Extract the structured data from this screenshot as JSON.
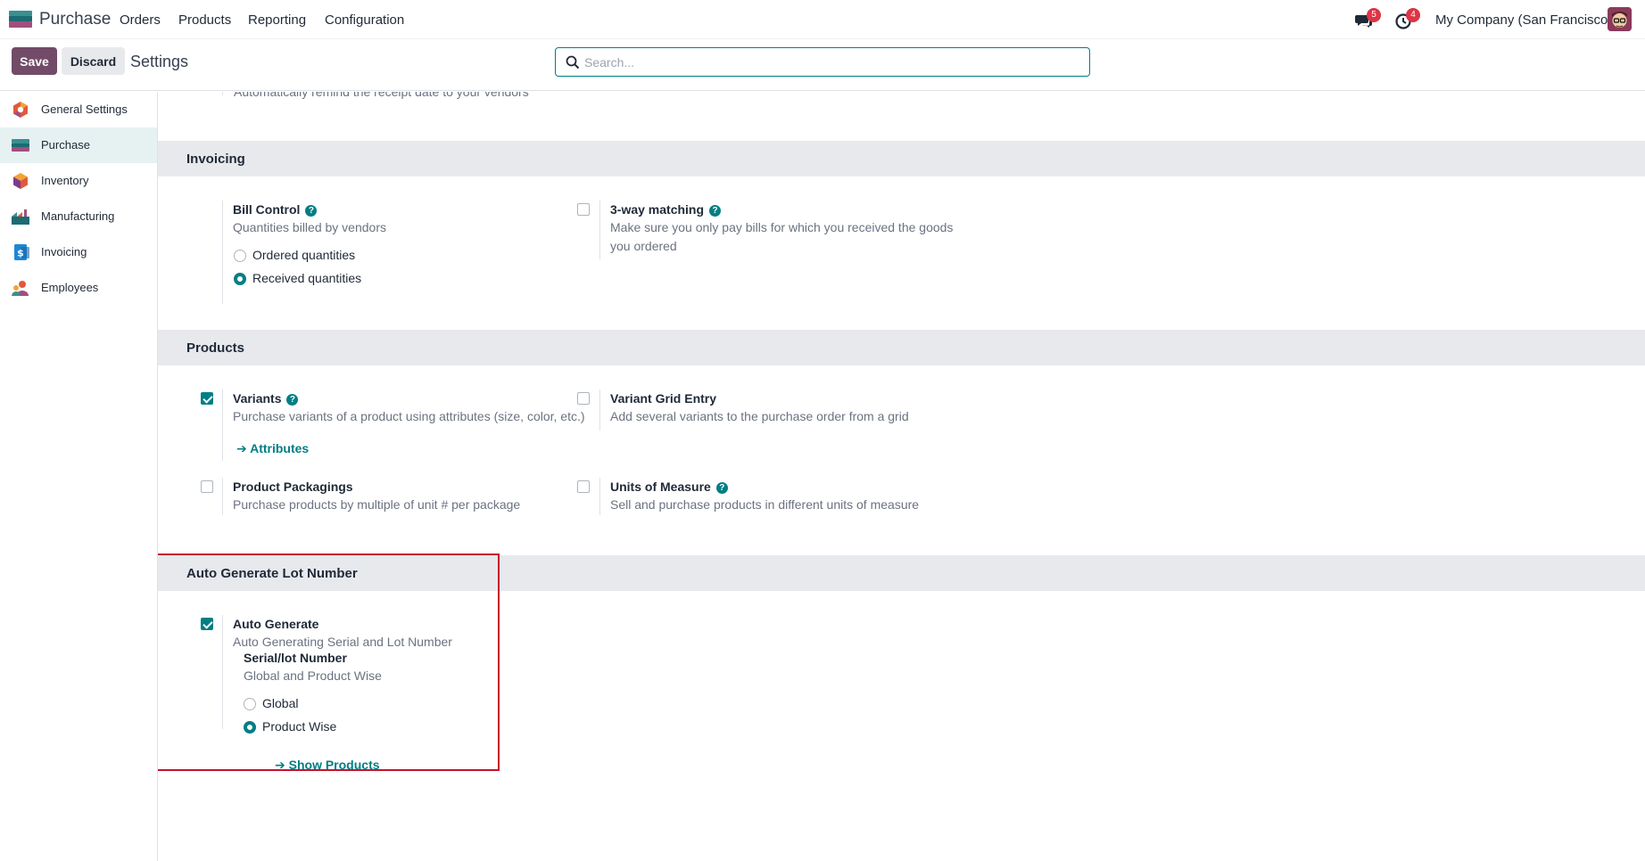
{
  "topbar": {
    "app_name": "Purchase",
    "menu": [
      "Orders",
      "Products",
      "Reporting",
      "Configuration"
    ],
    "messages_count": "5",
    "activities_count": "4",
    "company": "My Company (San Francisco)"
  },
  "control": {
    "save_label": "Save",
    "discard_label": "Discard",
    "title": "Settings",
    "search_placeholder": "Search..."
  },
  "sidebar": {
    "items": [
      {
        "label": "General Settings",
        "icon": "general-settings-icon"
      },
      {
        "label": "Purchase",
        "icon": "purchase-icon",
        "active": true
      },
      {
        "label": "Inventory",
        "icon": "inventory-icon"
      },
      {
        "label": "Manufacturing",
        "icon": "manufacturing-icon"
      },
      {
        "label": "Invoicing",
        "icon": "invoicing-icon"
      },
      {
        "label": "Employees",
        "icon": "employees-icon"
      }
    ]
  },
  "content": {
    "cutoff_text": "Automatically remind the receipt date to your vendors",
    "invoicing": {
      "heading": "Invoicing",
      "bill_control": {
        "title": "Bill Control",
        "desc": "Quantities billed by vendors",
        "options": [
          "Ordered quantities",
          "Received quantities"
        ],
        "selected": 1
      },
      "three_way": {
        "title": "3-way matching",
        "desc": "Make sure you only pay bills for which you received the goods you ordered",
        "checked": false
      }
    },
    "products": {
      "heading": "Products",
      "variants": {
        "title": "Variants",
        "desc": "Purchase variants of a product using attributes (size, color, etc.)",
        "checked": true,
        "link": "Attributes"
      },
      "variant_grid": {
        "title": "Variant Grid Entry",
        "desc": "Add several variants to the purchase order from a grid",
        "checked": false
      },
      "packagings": {
        "title": "Product Packagings",
        "desc": "Purchase products by multiple of unit # per package",
        "checked": false
      },
      "uom": {
        "title": "Units of Measure",
        "desc": "Sell and purchase products in different units of measure",
        "checked": false
      }
    },
    "lot": {
      "heading": "Auto Generate Lot Number",
      "auto_generate": {
        "title": "Auto Generate",
        "desc": "Auto Generating Serial and Lot Number",
        "checked": true
      },
      "serial": {
        "title": "Serial/lot Number",
        "desc": "Global and Product Wise",
        "options": [
          "Global",
          "Product Wise"
        ],
        "selected": 1
      },
      "link": "Show Products"
    }
  },
  "colors": {
    "brand": "#714b67",
    "accent": "#017e84",
    "highlight": "#c8102e"
  }
}
